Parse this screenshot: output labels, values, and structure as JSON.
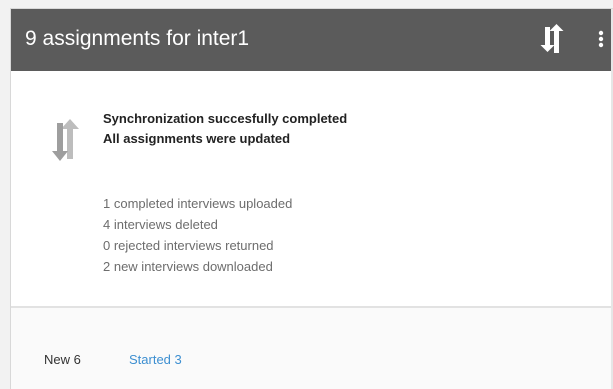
{
  "appbar": {
    "title": "9 assignments for inter1",
    "sync_icon": "sync-arrows-icon",
    "overflow_icon": "more-vert-icon",
    "background_color": "#5b5b5b"
  },
  "sync": {
    "status_icon": "sync-arrows-icon",
    "messages": [
      "Synchronization succesfully completed",
      "All assignments were updated"
    ],
    "stats": [
      "1 completed interviews uploaded",
      "4 interviews deleted",
      "0 rejected interviews returned",
      "2 new interviews downloaded"
    ]
  },
  "tabs": [
    {
      "label": "New 6",
      "active": false
    },
    {
      "label": "Started 3",
      "active": true
    }
  ],
  "colors": {
    "accent": "#3d8fd1",
    "stats_text": "#6d6d6d"
  }
}
